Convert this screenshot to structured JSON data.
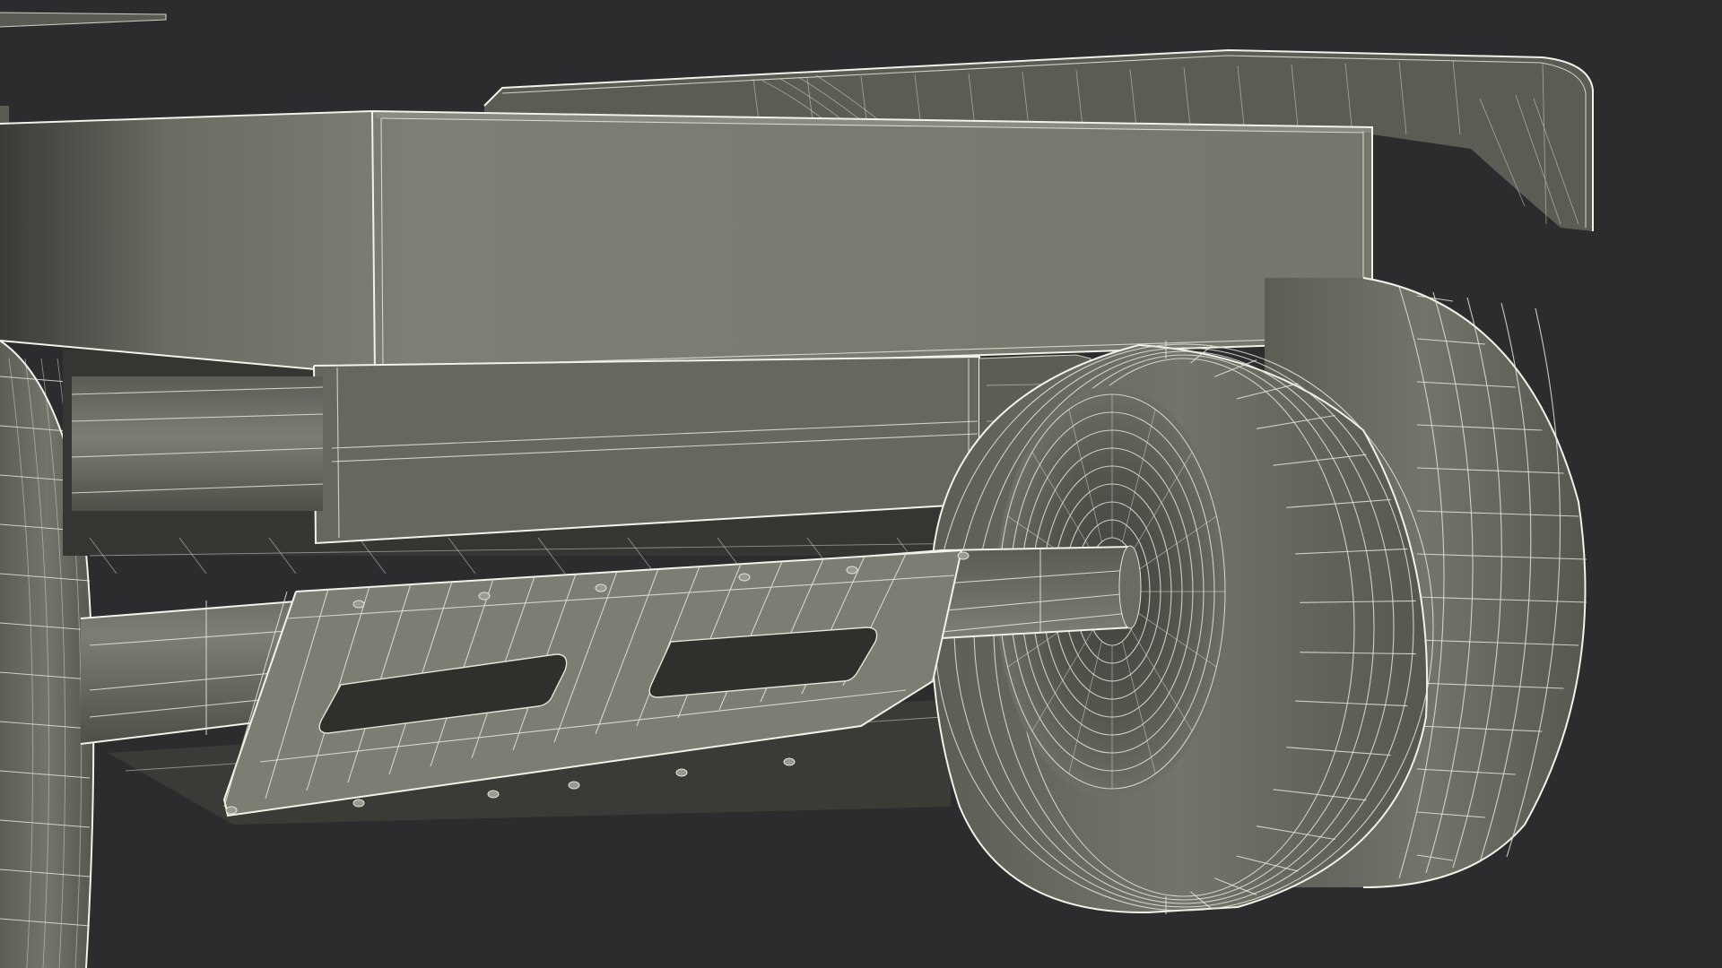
{
  "scene": {
    "background_color": "#2c2c2e",
    "mesh_color": "#7a7b70",
    "mesh_dark": "#4a4b44",
    "wire_color": "#e4e4d8"
  }
}
